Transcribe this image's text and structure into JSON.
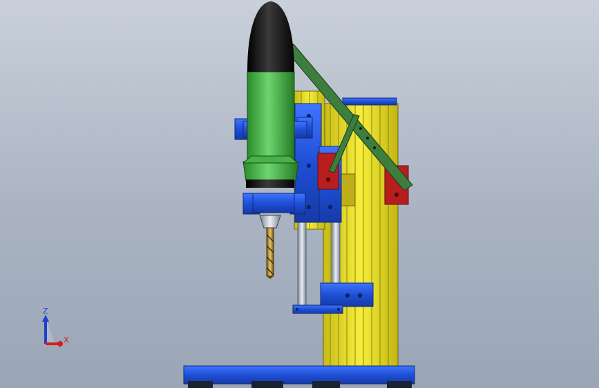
{
  "viewport": {
    "background_top": "#c9d0da",
    "background_bottom": "#9aa5b6"
  },
  "model": {
    "parts": [
      "motor-nose-cone",
      "motor-body",
      "motor-clamp-upper",
      "motor-clamp-lower",
      "chuck",
      "drill-bit",
      "column",
      "carriage-plate",
      "feed-lever",
      "lever-link",
      "guide-rod-left",
      "guide-rod-right",
      "bottom-bracket",
      "base-plate",
      "red-pivot-block-left",
      "red-pivot-block-right"
    ],
    "colors": {
      "motor_green": "#3aa83a",
      "nose_black": "#111111",
      "clamp_blue": "#1f4fd6",
      "column_yellow": "#f0e52a",
      "lever_green": "#3d7d3d",
      "pivot_red": "#b81e1e",
      "rod_gray": "#b8c2cc",
      "drill_gold": "#c9a24a"
    }
  },
  "triad": {
    "z_label": "Z",
    "x_label": "X",
    "z_color": "#1f3fd1",
    "x_color": "#d11f1f"
  }
}
